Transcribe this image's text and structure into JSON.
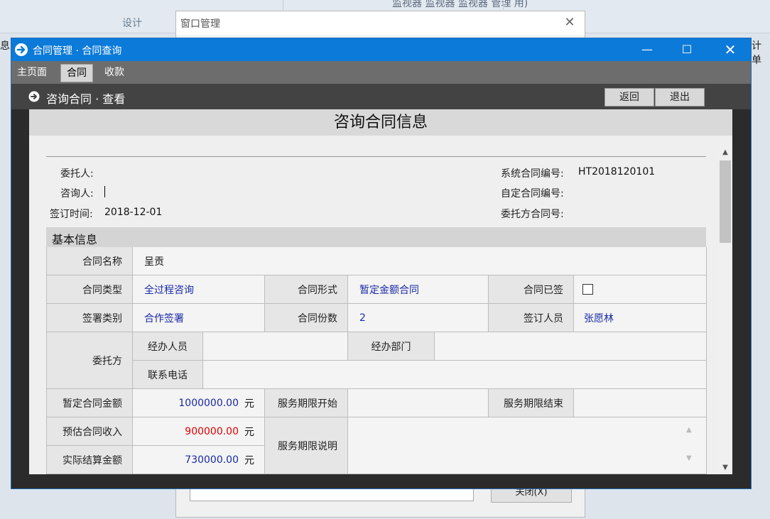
{
  "background": {
    "design_label": "设计",
    "top_right_text": "监视器 监视器 监视器     管理  用)",
    "left_fragment": "息",
    "right_fragment": "计单"
  },
  "window_manager": {
    "title": "窗口管理",
    "close_glyph": "✕",
    "button_label": "关闭(X)"
  },
  "main_window": {
    "title": "合同管理 · 合同查询",
    "min_glyph": "—",
    "max_glyph": "☐",
    "close_glyph": "✕"
  },
  "tabs": [
    {
      "label": "主页面",
      "active": false
    },
    {
      "label": "合同",
      "active": true
    },
    {
      "label": "收款",
      "active": false
    }
  ],
  "subbar": {
    "title": "咨询合同 · 查看",
    "back_label": "返回",
    "exit_label": "退出"
  },
  "form": {
    "header": "咨询合同信息",
    "client_label": "委托人:",
    "client_value": "",
    "consultant_label": "咨询人:",
    "consultant_value": "",
    "sign_date_label": "签订时间:",
    "sign_date_value": "2018-12-01",
    "sys_no_label": "系统合同编号:",
    "sys_no_value": "HT2018120101",
    "custom_no_label": "自定合同编号:",
    "custom_no_value": "",
    "client_no_label": "委托方合同号:",
    "client_no_value": "",
    "section_basic": "基本信息"
  },
  "table": {
    "name_label": "合同名称",
    "name_value": "呈贡",
    "type_label": "合同类型",
    "type_value": "全过程咨询",
    "form_label": "合同形式",
    "form_value": "暂定金额合同",
    "signed_label": "合同已签",
    "signed_checked": false,
    "sign_category_label": "签署类别",
    "sign_category_value": "合作签署",
    "copies_label": "合同份数",
    "copies_value": "2",
    "signer_label": "签订人员",
    "signer_value": "张愿林",
    "client_party_label": "委托方",
    "handler_label": "经办人员",
    "handler_value": "",
    "dept_label": "经办部门",
    "dept_value": "",
    "phone_label": "联系电话",
    "phone_value": "",
    "tentative_amount_label": "暂定合同金额",
    "tentative_amount_value": "1000000.00",
    "service_start_label": "服务期限开始",
    "service_start_value": "",
    "service_end_label": "服务期限结束",
    "service_end_value": "",
    "estimated_income_label": "预估合同收入",
    "estimated_income_value": "900000.00",
    "service_desc_label": "服务期限说明",
    "service_desc_value": "",
    "actual_amount_label": "实际结算金额",
    "actual_amount_value": "730000.00",
    "unit": "元"
  },
  "colors": {
    "titlebar": "#0b7ad8",
    "link_blue": "#1a2aa8",
    "income_red": "#e00000"
  }
}
